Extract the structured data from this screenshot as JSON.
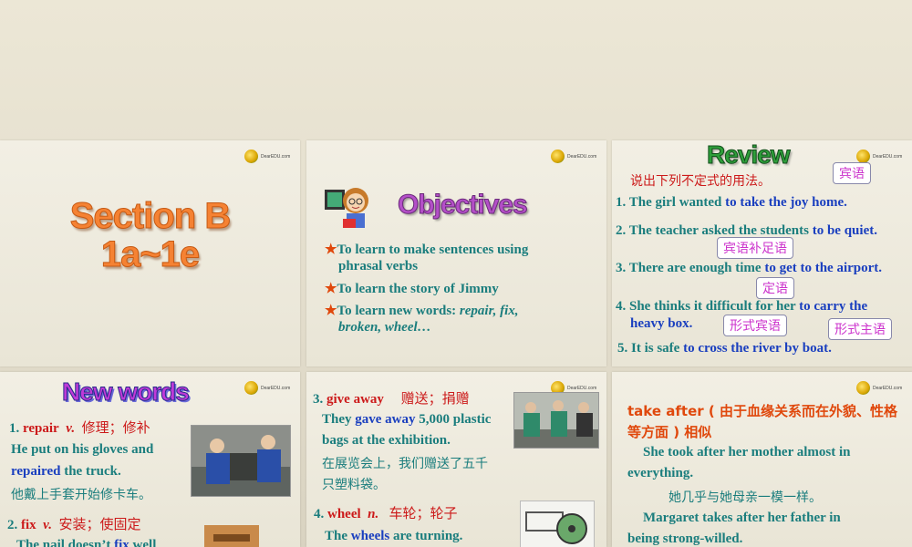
{
  "logo_text": "DearEDU.com",
  "slide1": {
    "title_line1": "Section B",
    "title_line2": "1a~1e"
  },
  "slide2": {
    "title": "Objectives",
    "obj1_line1": "To learn to make sentences using",
    "obj1_line2": "phrasal verbs",
    "obj2": "To learn the story of Jimmy",
    "obj3_prefix": "To learn new words: ",
    "obj3_words1": "repair, fix,",
    "obj3_words2": "broken, wheel…"
  },
  "slide3": {
    "title": "Review",
    "instruction": "说出下列不定式的用法。",
    "s1_a": "1. The girl wanted ",
    "s1_b": "to take the joy home.",
    "s2_a": "2. The teacher asked the students ",
    "s2_b": "to be quiet.",
    "s3_a": "3. There are enough time ",
    "s3_b": "to get to the airport.",
    "s4_a": "4. She thinks it difficult for her ",
    "s4_b": "to carry the",
    "s4_c": "heavy box.",
    "s5_a": "5. It is safe ",
    "s5_b": "to cross the river by boat.",
    "c1": "宾语",
    "c2": "宾语补足语",
    "c3": "定语",
    "c4": "形式宾语",
    "c5": "形式主语"
  },
  "slide4": {
    "title": "New words",
    "w1_num": "1. ",
    "w1_word": "repair",
    "w1_pos": "v.",
    "w1_cn": "修理；修补",
    "w1_ex1": "He put on his gloves and",
    "w1_ex2a": "repaired",
    "w1_ex2b": " the truck.",
    "w1_cn_ex": "他戴上手套开始修卡车。",
    "w2_num": "2. ",
    "w2_word": "fix",
    "w2_pos": "v.",
    "w2_cn": "安装；使固定",
    "w2_ex_a": "The nail doesn’t ",
    "w2_ex_b": "fix",
    "w2_ex_c": " well"
  },
  "slide5": {
    "w3_num": "3. ",
    "w3_word": "give away",
    "w3_cn": "赠送；捐赠",
    "w3_ex1a": "They ",
    "w3_ex1b": "gave away",
    "w3_ex1c": " 5,000 plastic",
    "w3_ex2": "bags at the exhibition.",
    "w3_cn1": "在展览会上，我们赠送了五千",
    "w3_cn2": "只塑料袋。",
    "w4_num": "4. ",
    "w4_word": "wheel",
    "w4_pos": "n.",
    "w4_cn": "车轮；轮子",
    "w4_ex_a": "The ",
    "w4_ex_b": "wheels",
    "w4_ex_c": " are turning."
  },
  "slide6": {
    "line1": "take after ( 由于血缘关系而在外貌、性格",
    "line2": "等方面 ) 相似",
    "ex1a": "She took after her mother almost in",
    "ex1b": "everything.",
    "cn1": "她几乎与她母亲一模一样。",
    "ex2a": "Margaret takes after her father in",
    "ex2b": "being strong-willed."
  }
}
